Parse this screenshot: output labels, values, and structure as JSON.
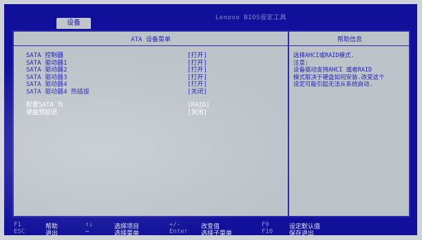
{
  "window": {
    "title": "Lenovo BIOS设定工具"
  },
  "tabs": [
    {
      "label": "设备"
    }
  ],
  "main": {
    "header": "ATA 设备菜单",
    "items": [
      {
        "label": "SATA 控制器",
        "value": "[打开]"
      },
      {
        "label": "SATA 驱动器1",
        "value": "[打开]"
      },
      {
        "label": "SATA 驱动器2",
        "value": "[打开]"
      },
      {
        "label": "SATA 驱动器3",
        "value": "[打开]"
      },
      {
        "label": "SATA 驱动器4",
        "value": "[打开]"
      },
      {
        "label": "SATA 驱动器4 热插拔",
        "value": "[关闭]"
      }
    ],
    "config_items": [
      {
        "label": "配置SATA 为",
        "value": "[RAID]"
      },
      {
        "label": "硬盘预延迟",
        "value": "[关闭]"
      }
    ]
  },
  "help": {
    "header": "帮助信息",
    "lines": [
      "选择AHCI或RAID模式.",
      "注意:",
      "设备驱动支持AHCI 或者RAID",
      "模式取决于硬盘如何安装.改变这个",
      "设定可能引起无法从系统启动."
    ]
  },
  "footer": {
    "keys": [
      {
        "key": "F1",
        "desc": "帮助"
      },
      {
        "key": "ESC",
        "desc": "退出"
      },
      {
        "key": "↑↓",
        "desc": "选择项目"
      },
      {
        "key": "↔",
        "desc": "选择菜单"
      },
      {
        "key": "+/-",
        "desc": "改变值"
      },
      {
        "key": "Enter",
        "desc": "选择子菜单"
      },
      {
        "key": "F9",
        "desc": "设定默认值"
      },
      {
        "key": "F10",
        "desc": "保存退出"
      }
    ]
  }
}
